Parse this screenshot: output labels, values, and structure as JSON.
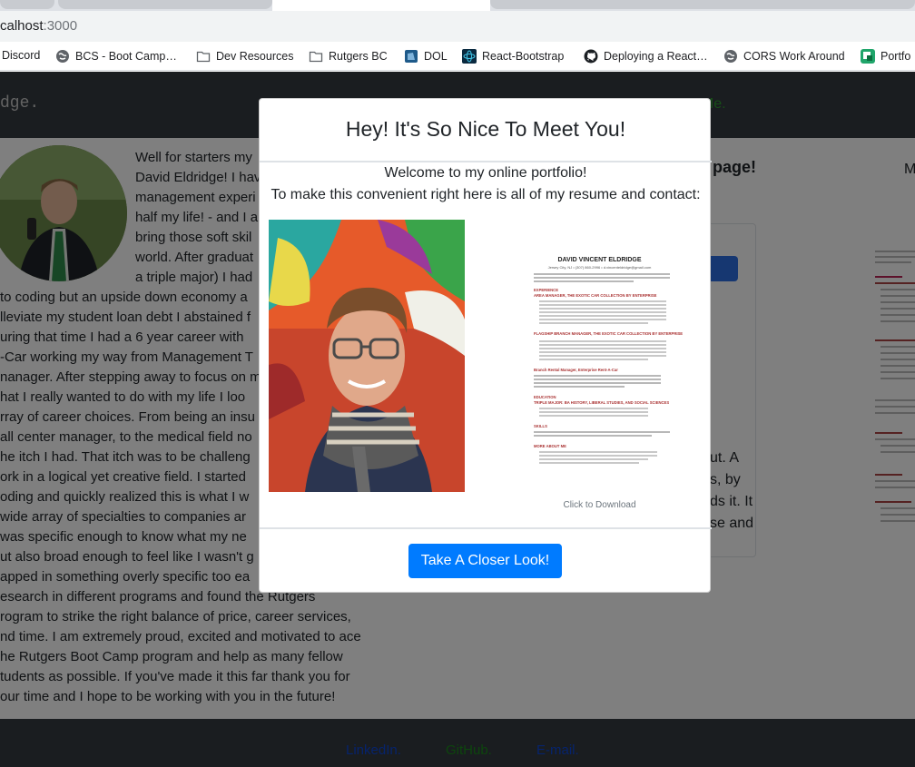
{
  "browser": {
    "url_host": "calhost",
    "url_port": ":3000",
    "bookmarks": [
      {
        "label": "Discord",
        "icon": "discord-icon"
      },
      {
        "label": "BCS - Boot Camp…",
        "icon": "globe-icon"
      },
      {
        "label": "Dev Resources",
        "icon": "folder-icon"
      },
      {
        "label": "Rutgers BC",
        "icon": "folder-icon"
      },
      {
        "label": "DOL",
        "icon": "dol-icon"
      },
      {
        "label": "React-Bootstrap",
        "icon": "react-bootstrap-icon"
      },
      {
        "label": "Deploying a React…",
        "icon": "github-icon"
      },
      {
        "label": "CORS Work Around",
        "icon": "globe-icon"
      },
      {
        "label": "Portfo",
        "icon": "portfolio-icon"
      }
    ]
  },
  "site": {
    "brand": "dge.",
    "nav_contact": "t Me.",
    "bio_lines": [
      "Well for starters my",
      "David Eldridge! I hav",
      "management experi",
      "half my life! - and I a",
      "bring those soft skil",
      "world. After graduat",
      "a triple major) I had",
      "to coding but an upside down economy a",
      "lleviate my student loan debt I abstained f",
      "uring that time I had a 6 year career with",
      "-Car working my way from Management T",
      "nanager. After stepping away to focus on m",
      "hat I really wanted to do with my life I loo",
      "rray of career choices. From being an insu",
      "all center manager, to the medical field no",
      "he itch I had. That itch was to be challeng",
      "ork in a logical yet creative field. I started",
      "oding and quickly realized this is what I w",
      " wide array of specialties to companies ar",
      " was specific enough to know what my ne",
      "ut also broad enough to feel like I wasn't g",
      "apped in something overly specific too ea",
      "esearch in different programs and found the Rutgers",
      "rogram to strike the right balance of price, career services,",
      "nd time. I am extremely proud, excited and motivated to ace",
      "he Rutgers Boot Camp program and help as many fellow",
      "tudents as possible. If you've made it this far thank you for",
      "our time and I hope to be working with you in the future!"
    ],
    "right_heading": "page!",
    "right_m": "M",
    "card_text_lines": [
      "ut. A",
      "s, by",
      "ds it. It",
      "se and"
    ],
    "footer_links": [
      {
        "label": "LinkedIn.",
        "color": "#0d47d9"
      },
      {
        "label": "GitHub.",
        "color": "#1a8a1a"
      },
      {
        "label": "E-mail.",
        "color": "#0d47d9"
      }
    ]
  },
  "modal": {
    "title": "Hey! It's So Nice To Meet You!",
    "welcome": "Welcome to my online portfolio!",
    "subtitle": "To make this convenient right here is all of my resume and contact:",
    "download_caption": "Click to Download",
    "button_label": "Take A Closer Look!",
    "resume": {
      "name": "DAVID VINCENT ELDRIDGE",
      "contact": "Jersey City, NJ • (307) 860-2996 • d.vincenteldridge@gmail.com",
      "sections": [
        "EXPERIENCE",
        "AREA MANAGER, THE EXOTIC CAR COLLECTION BY ENTERPRISE",
        "FLAGSHIP BRANCH MANAGER, THE EXOTIC CAR COLLECTION BY ENTERPRISE",
        "Branch Rental Manager, Enterprise Rent-A-Car",
        "EDUCATION",
        "TRIPLE MAJOR: BA HISTORY, LIBERAL STUDIES, AND SOCIAL SCIENCES",
        "SKILLS",
        "MORE ABOUT ME"
      ]
    }
  },
  "colors": {
    "primary": "#007bff",
    "nav_bg": "#343a40",
    "accent_green": "#2e9e2e"
  }
}
